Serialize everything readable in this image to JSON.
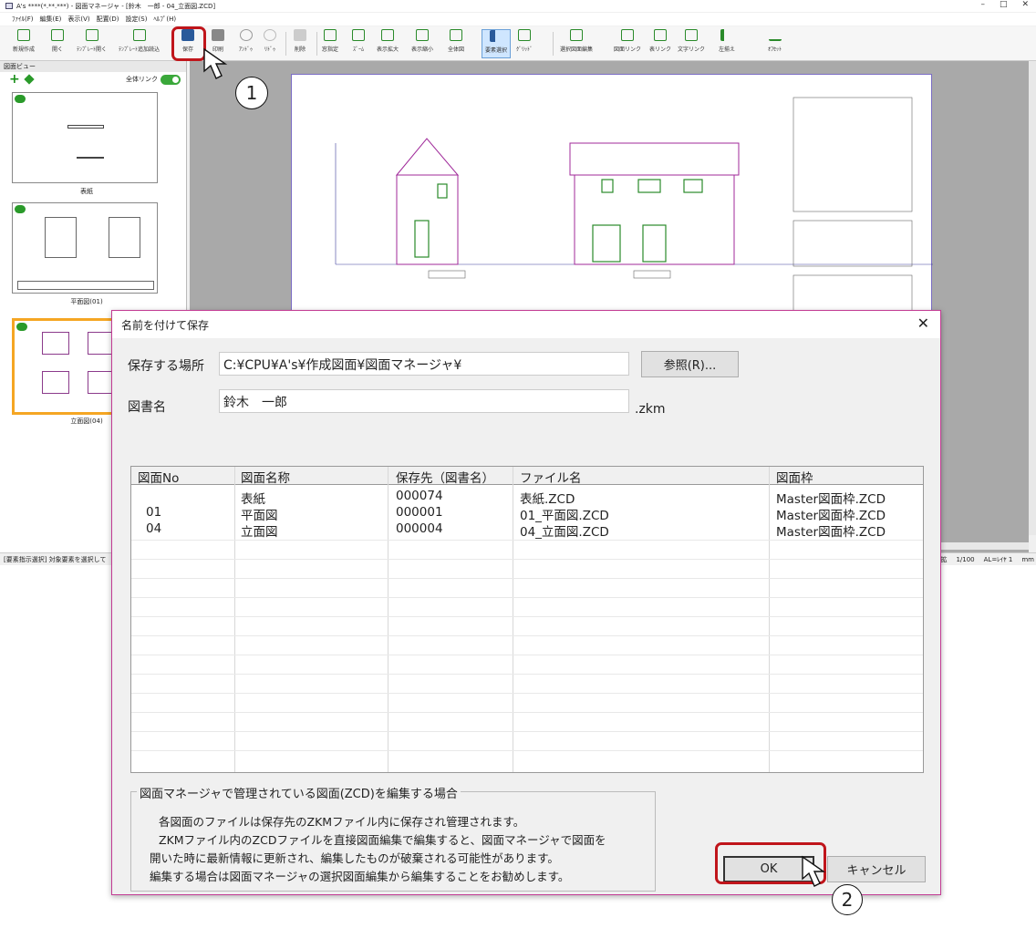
{
  "window": {
    "title": "A's ****(*.**.***) - 図面マネージャ - [鈴木　一郎 - 04_立面図.ZCD]",
    "controls": [
      "–",
      "□",
      "✕"
    ]
  },
  "menu": [
    "ﾌｧｲﾙ(F)",
    "編集(E)",
    "表示(V)",
    "配置(D)",
    "設定(S)",
    "ﾍﾙﾌﾟ(H)"
  ],
  "toolbar": {
    "buttons": [
      "新規作成",
      "開く",
      "ﾃﾝﾌﾟﾚｰﾄ開く",
      "ﾃﾝﾌﾟﾚｰﾄ追加読込",
      "保存",
      "印刷",
      "ｱﾝﾄﾞｩ",
      "ﾘﾄﾞｩ",
      "削除",
      "窓指定",
      "ｽﾞｰﾑ",
      "表示拡大",
      "表示縮小",
      "全体図",
      "要素選択",
      "ｸﾞﾘｯﾄﾞ",
      "選択図面編集",
      "図面リンク",
      "表リンク",
      "文字リンク",
      "左揃え",
      "ｵﾌｾｯﾄ"
    ]
  },
  "sidebar": {
    "header": "図面ビュー",
    "all_link_label": "全体リンク",
    "thumbnails": [
      {
        "label": "表紙"
      },
      {
        "label": "平面図(01)"
      },
      {
        "label": "立面図(04)"
      }
    ]
  },
  "status": {
    "left": "[要素指示選択] 対象要素を選択して",
    "right": [
      "拡",
      "1/100",
      "AL=ﾚｲﾔ 1",
      "mm"
    ]
  },
  "dialog": {
    "title": "名前を付けて保存",
    "close": "✕",
    "location_label": "保存する場所",
    "location_value": "C:¥CPU¥A's¥作成図面¥図面マネージャ¥",
    "browse_button": "参照(R)...",
    "name_label": "図書名",
    "name_value": "鈴木　一郎",
    "extension": ".zkm",
    "table": {
      "headers": [
        "図面No",
        "図面名称",
        "保存先（図書名）",
        "ファイル名",
        "図面枠"
      ],
      "rows": [
        [
          "",
          "表紙",
          "000074",
          "表紙.ZCD",
          "Master図面枠.ZCD"
        ],
        [
          "01",
          "平面図",
          "000001",
          "01_平面図.ZCD",
          "Master図面枠.ZCD"
        ],
        [
          "04",
          "立面図",
          "000004",
          "04_立面図.ZCD",
          "Master図面枠.ZCD"
        ]
      ]
    },
    "info": {
      "title": "図面マネージャで管理されている図面(ZCD)を編集する場合",
      "lines": [
        "各図面のファイルは保存先のZKMファイル内に保存され管理されます。",
        "ZKMファイル内のZCDファイルを直接図面編集で編集すると、図面マネージャで図面を",
        "開いた時に最新情報に更新され、編集したものが破棄される可能性があります。",
        "編集する場合は図面マネージャの選択図面編集から編集することをお勧めします。"
      ]
    },
    "ok_button": "OK",
    "cancel_button": "キャンセル"
  },
  "callouts": [
    "1",
    "2"
  ],
  "colors": {
    "accent_red": "#c0151b",
    "selection_orange": "#f5a623",
    "dialog_border": "#c23b93",
    "link_green": "#2a9a2a"
  }
}
